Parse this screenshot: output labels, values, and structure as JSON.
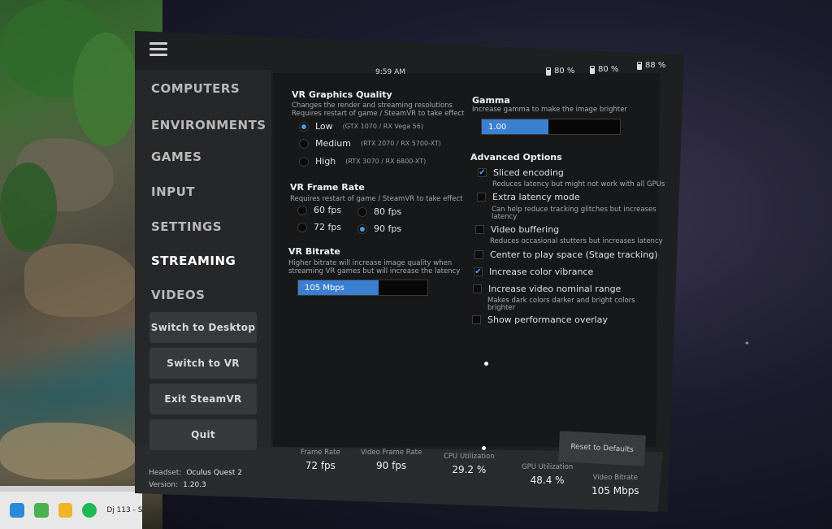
{
  "status_bar": {
    "time": "9:59 AM",
    "batteries": [
      "80 %",
      "80 %",
      "88 %"
    ]
  },
  "sidebar": {
    "items": [
      {
        "label": "COMPUTERS",
        "active": false
      },
      {
        "label": "ENVIRONMENTS",
        "active": false
      },
      {
        "label": "GAMES",
        "active": false
      },
      {
        "label": "INPUT",
        "active": false
      },
      {
        "label": "SETTINGS",
        "active": false
      },
      {
        "label": "STREAMING",
        "active": true
      },
      {
        "label": "VIDEOS",
        "active": false
      }
    ],
    "buttons": [
      "Switch to Desktop",
      "Switch to VR",
      "Exit SteamVR",
      "Quit"
    ]
  },
  "graphics_quality": {
    "title": "VR Graphics Quality",
    "desc1": "Changes the render and streaming resolutions",
    "desc2": "Requires restart of game / SteamVR to take effect",
    "options": [
      {
        "label": "Low",
        "sub": "(GTX 1070 / RX Vega 56)",
        "selected": true
      },
      {
        "label": "Medium",
        "sub": "(RTX 2070 / RX 5700-XT)",
        "selected": false
      },
      {
        "label": "High",
        "sub": "(RTX 3070 / RX 6800-XT)",
        "selected": false
      }
    ]
  },
  "frame_rate": {
    "title": "VR Frame Rate",
    "desc": "Requires restart of game / SteamVR to take effect",
    "options": [
      {
        "label": "60 fps",
        "selected": false
      },
      {
        "label": "80 fps",
        "selected": false
      },
      {
        "label": "72 fps",
        "selected": false
      },
      {
        "label": "90 fps",
        "selected": true
      }
    ]
  },
  "bitrate": {
    "title": "VR Bitrate",
    "desc1": "Higher bitrate will increase image quality when",
    "desc2": "streaming VR games but will increase the latency",
    "value_label": "105 Mbps",
    "fill_fraction": 0.62
  },
  "gamma": {
    "title": "Gamma",
    "desc": "Increase gamma to make the image brighter",
    "value_label": "1.00",
    "fill_fraction": 0.48
  },
  "advanced": {
    "title": "Advanced Options",
    "options": [
      {
        "label": "Sliced encoding",
        "checked": true,
        "desc": [
          "Reduces latency but might not work with all GPUs"
        ]
      },
      {
        "label": "Extra latency mode",
        "checked": false,
        "desc": [
          "Can help reduce tracking glitches but increases",
          "latency"
        ]
      },
      {
        "label": "Video buffering",
        "checked": false,
        "desc": [
          "Reduces occasional stutters but increases latency"
        ]
      },
      {
        "label": "Center to play space (Stage tracking)",
        "checked": false,
        "desc": []
      },
      {
        "label": "Increase color vibrance",
        "checked": true,
        "desc": []
      },
      {
        "label": "Increase video nominal range",
        "checked": false,
        "desc": [
          "Makes dark colors darker and bright colors",
          "brighter"
        ]
      },
      {
        "label": "Show performance overlay",
        "checked": false,
        "desc": []
      }
    ]
  },
  "reset_button": "Reset to Defaults",
  "footer": {
    "headset_label": "Headset:",
    "headset_value": "Oculus Quest 2",
    "version_label": "Version:",
    "version_value": "1.20.3",
    "stats": [
      {
        "label": "Frame Rate",
        "value": "72 fps"
      },
      {
        "label": "Video Frame Rate",
        "value": "90 fps"
      },
      {
        "label": "CPU Utilization",
        "value": "29.2 %"
      },
      {
        "label": "GPU Utilization",
        "value": "48.4 %"
      },
      {
        "label": "Video Bitrate",
        "value": "105 Mbps"
      }
    ]
  },
  "taskbar": {
    "items": [
      "Dj 113 - S"
    ]
  },
  "colors": {
    "accent": "#3a7fd0",
    "radio_on": "#4b9be8",
    "panel_bg": "#1e1f21"
  }
}
